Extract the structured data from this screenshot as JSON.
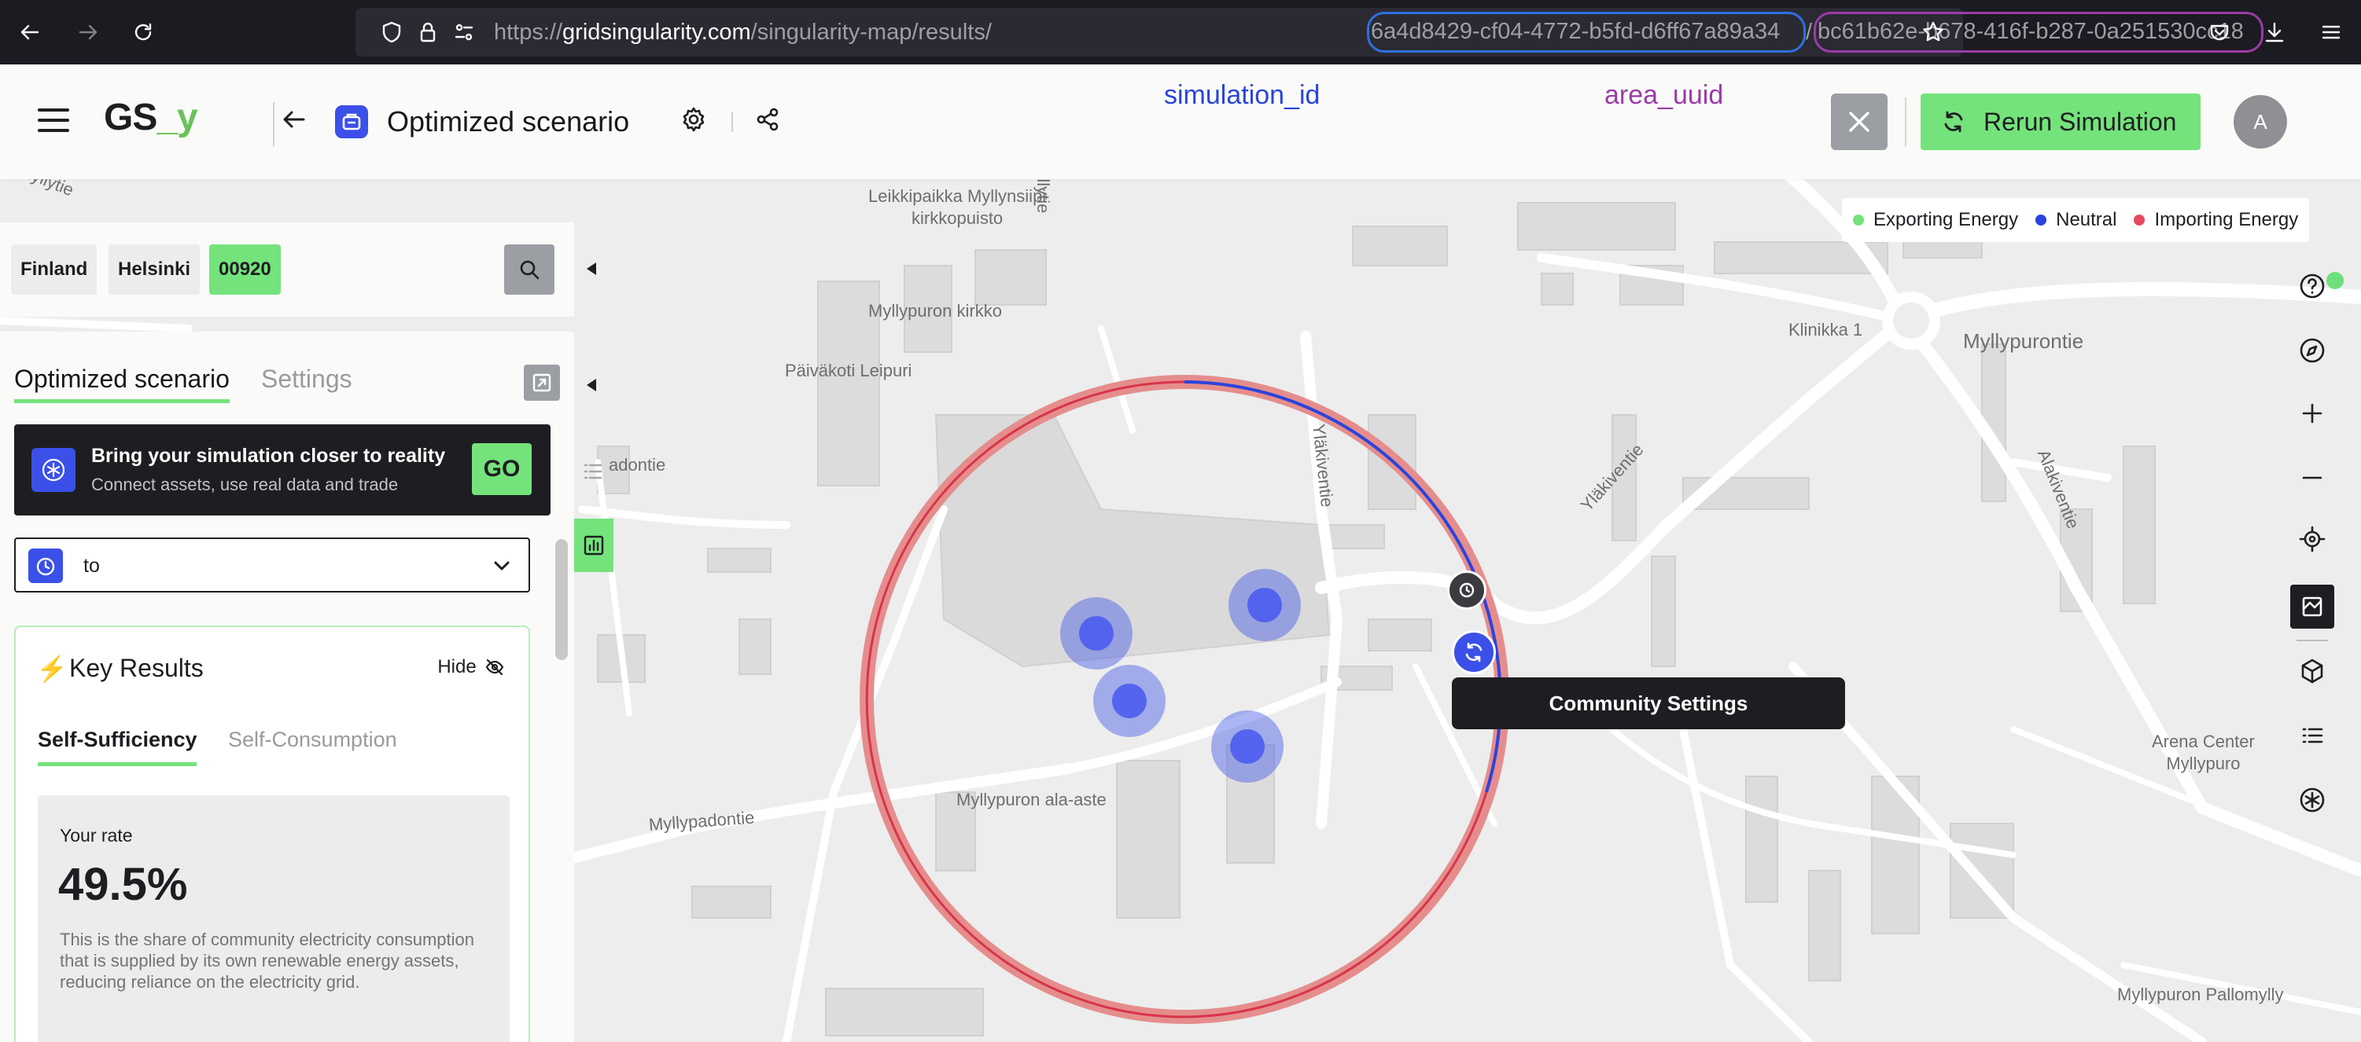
{
  "browser": {
    "url_prefix": "https://",
    "url_domain": "gridsingularity.com",
    "url_path": "/singularity-map/results/",
    "simulation_id": "6a4d8429-cf04-4772-b5fd-d6ff67a89a34",
    "url_slash": "/",
    "area_uuid": "bc61b62e-b678-416f-b287-0a251530cc18"
  },
  "header": {
    "logo_main": "GS",
    "logo_accent": "_y",
    "title": "Optimized scenario",
    "annotation_simulation_id": "simulation_id",
    "annotation_area_uuid": "area_uuid",
    "rerun_label": "Rerun Simulation",
    "avatar_initial": "A"
  },
  "location": {
    "country": "Finland",
    "city": "Helsinki",
    "postal": "00920"
  },
  "panel": {
    "tab_active": "Optimized scenario",
    "tab_inactive": "Settings",
    "promo_title": "Bring your simulation closer to reality",
    "promo_subtitle": "Connect assets, use real data and trade",
    "promo_button": "GO",
    "scenario_value": "to",
    "key_results": {
      "title": "Key Results",
      "hide_label": "Hide",
      "tab_active": "Self-Sufficiency",
      "tab_inactive": "Self-Consumption",
      "rate_label": "Your rate",
      "rate_value": "49.5%",
      "description": "This is the share of community electricity consumption that is supplied by its own renewable energy assets, reducing reliance on the electricity grid."
    }
  },
  "legend": {
    "items": [
      {
        "label": "Exporting Energy",
        "color": "#74e37b"
      },
      {
        "label": "Neutral",
        "color": "#2a44db"
      },
      {
        "label": "Importing Energy",
        "color": "#e64a5f"
      }
    ]
  },
  "map": {
    "tooltip": "Community Settings",
    "labels": {
      "playground": "Leikkipaikka Myllynsiipi\nkirkkopuisto",
      "church": "Myllypuron kirkko",
      "daycare": "Päiväkoti Leipuri",
      "school": "Myllypuron ala-aste",
      "padontie_top": "adontie",
      "padontie": "Myllypadontie",
      "ylakiventie": "Yläkiventie",
      "ylakiventie2": "Yläkiventie",
      "klinikka": "Klinikka 1",
      "myllypurontie": "Myllypurontie",
      "alakiventie": "Alakiventie",
      "arena": "Arena Center\nMyllypuro",
      "pallomylly": "Myllypuron Pallomylly",
      "kirkkotie": "kkamyllytie",
      "myllytie": "myllytie"
    }
  },
  "colors": {
    "accent_green": "#74e37b",
    "brand_blue": "#3a50e8",
    "community_ring": "#e58d8d",
    "dark": "#1e1e22"
  }
}
